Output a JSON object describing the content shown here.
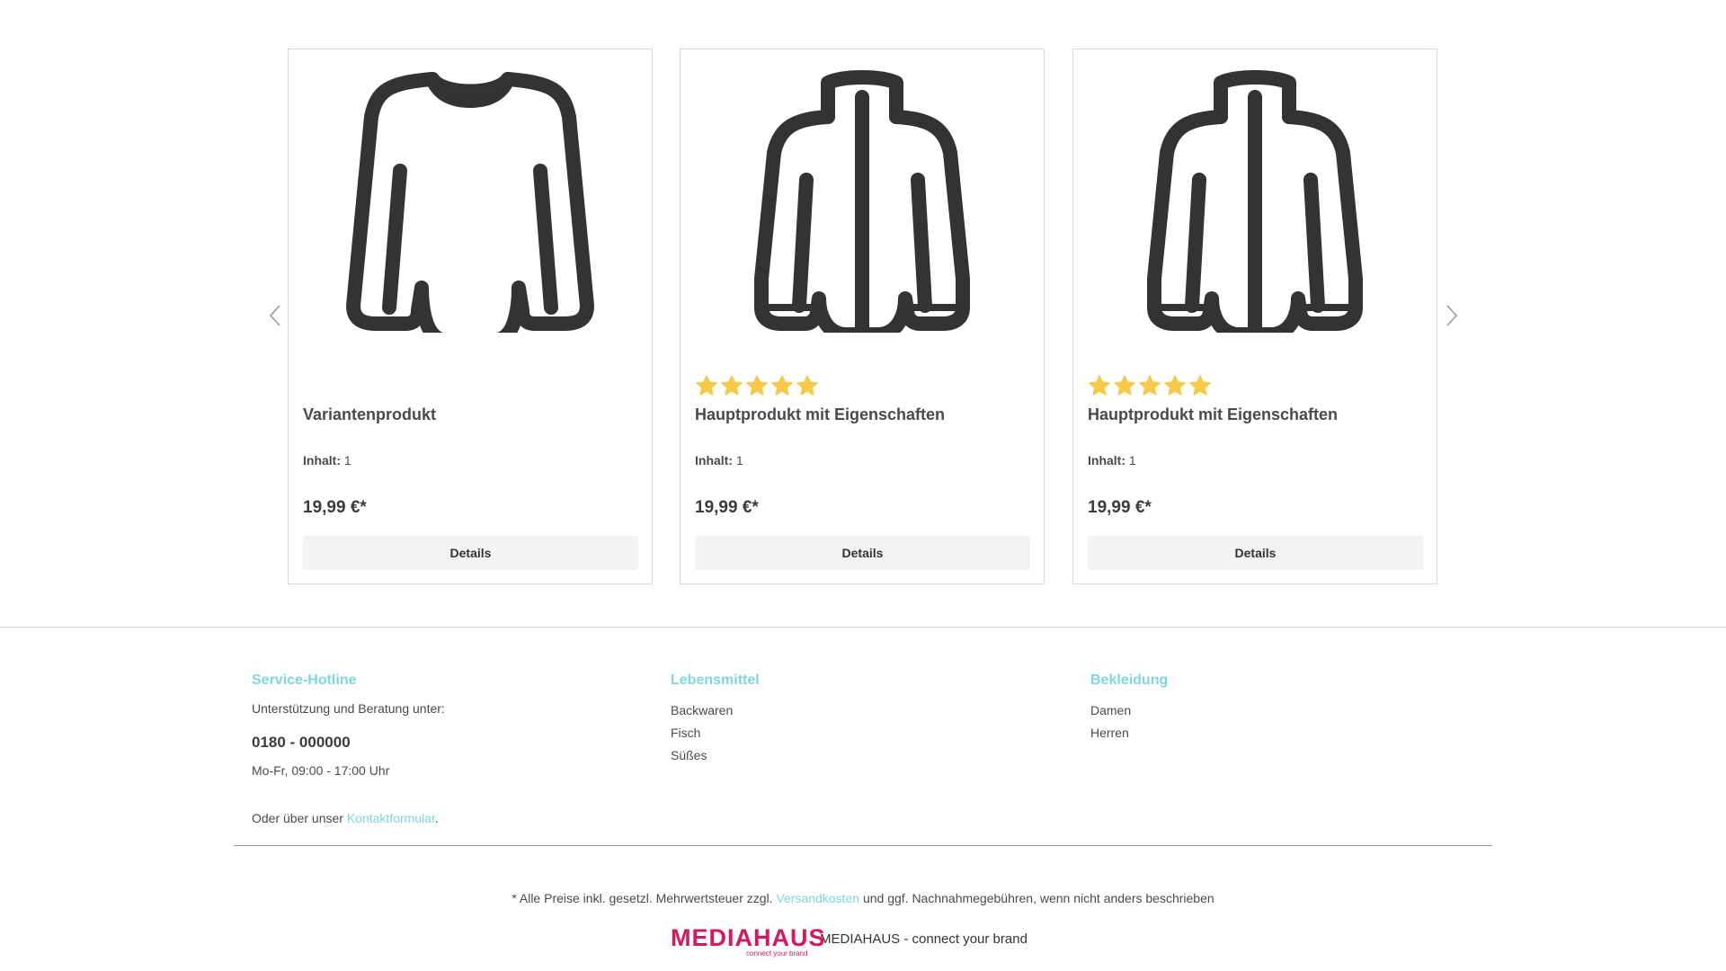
{
  "colors": {
    "accent": "#7fd6df",
    "star": "#f7c948",
    "brand": "#d6185f",
    "icon": "#333333"
  },
  "slider": {
    "prev_icon": "chevron-left-icon",
    "next_icon": "chevron-right-icon",
    "products": [
      {
        "image_icon": "long-sleeve-shirt-icon",
        "rating": null,
        "name": "Variantenprodukt",
        "content_label": "Inhalt:",
        "content_value": "1",
        "price": "19,99 €*",
        "details_label": "Details"
      },
      {
        "image_icon": "button-jacket-icon",
        "rating": 5,
        "name": "Hauptprodukt mit Eigenschaften",
        "content_label": "Inhalt:",
        "content_value": "1",
        "price": "19,99 €*",
        "details_label": "Details"
      },
      {
        "image_icon": "button-jacket-icon",
        "rating": 5,
        "name": "Hauptprodukt mit Eigenschaften",
        "content_label": "Inhalt:",
        "content_value": "1",
        "price": "19,99 €*",
        "details_label": "Details"
      }
    ]
  },
  "footer": {
    "hotline": {
      "heading": "Service-Hotline",
      "intro": "Unterstützung und Beratung unter:",
      "number": "0180 - 000000",
      "hours": "Mo-Fr, 09:00 - 17:00 Uhr",
      "contact_prefix": "Oder über unser ",
      "contact_link": "Kontaktformular",
      "contact_suffix": "."
    },
    "food": {
      "heading": "Lebensmittel",
      "items": [
        "Backwaren",
        "Fisch",
        "Süßes"
      ]
    },
    "clothing": {
      "heading": "Bekleidung",
      "items": [
        "Damen",
        "Herren"
      ]
    },
    "vat": {
      "prefix": "* Alle Preise inkl. gesetzl. Mehrwertsteuer zzgl. ",
      "link": "Versandkosten",
      "suffix": " und ggf. Nachnahmegebühren, wenn nicht anders beschrieben"
    },
    "brand": {
      "logo_word": "MEDIAHAUS",
      "logo_sub": "connect your brand",
      "text": "MEDIAHAUS - connect your brand"
    }
  }
}
